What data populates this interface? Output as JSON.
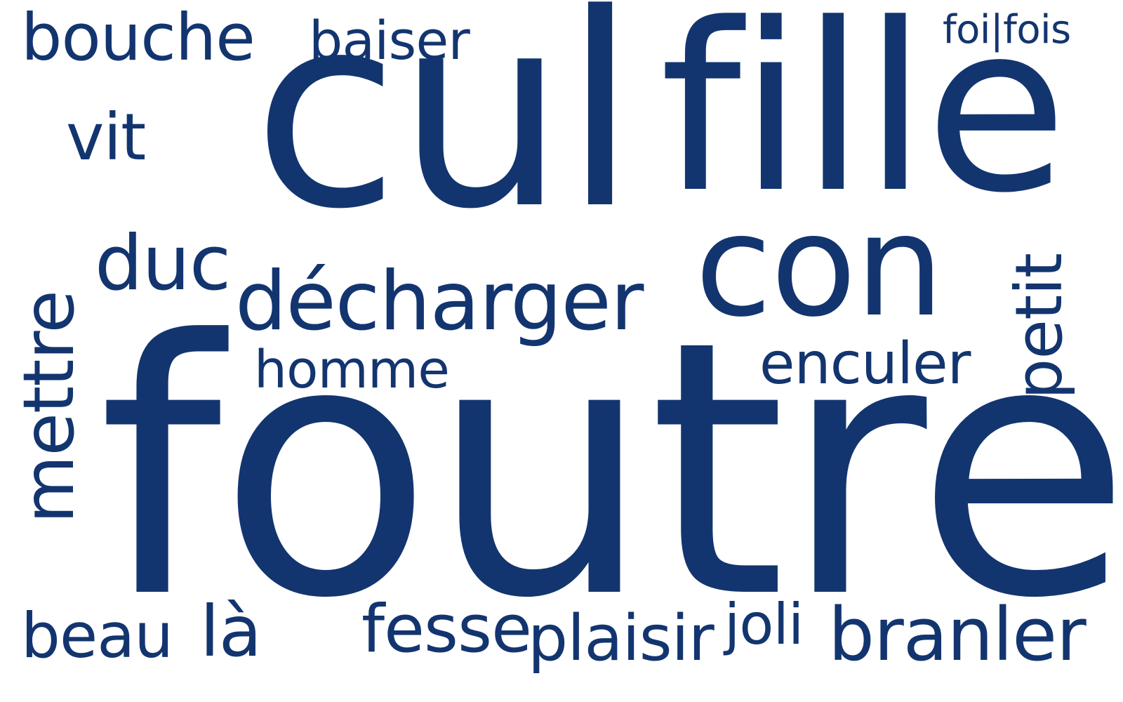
{
  "colors": {
    "background": "#ffffff",
    "words": "#13356f"
  },
  "words": {
    "foutre": "foutre",
    "cul": "cul",
    "fille": "fille",
    "con": "con",
    "decharger": "décharger",
    "bouche": "bouche",
    "baiser": "baiser",
    "foi_fois": "foi|fois",
    "vit": "vit",
    "duc": "duc",
    "mettre": "mettre",
    "homme": "homme",
    "enculer": "enculer",
    "petit": "petit",
    "beau": "beau",
    "la": "là",
    "fesse": "fesse",
    "plaisir": "plaisir",
    "joli": "joli",
    "branler": "branler"
  }
}
